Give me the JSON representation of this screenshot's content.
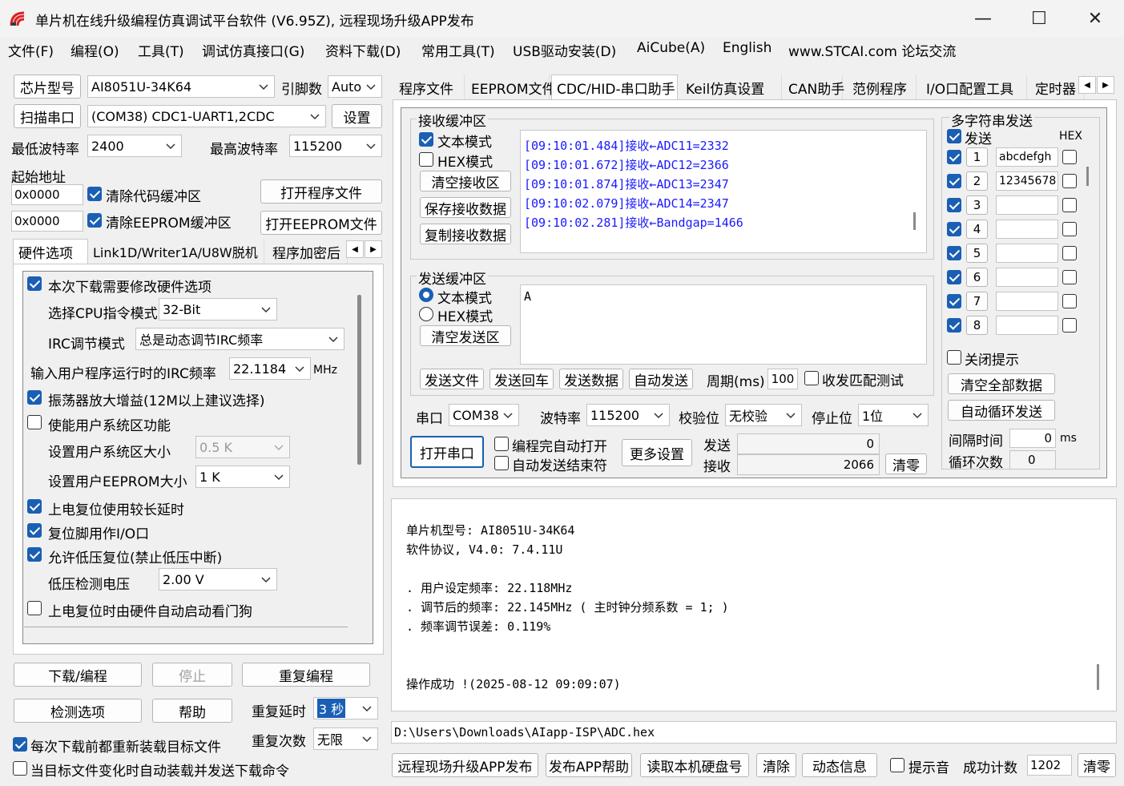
{
  "window": {
    "title": "单片机在线升级编程仿真调试平台软件 (V6.95Z), 远程现场升级APP发布"
  },
  "menu": [
    "文件(F)",
    "编程(O)",
    "工具(T)",
    "调试仿真接口(G)",
    "资料下载(D)",
    "常用工具(T)",
    "USB驱动安装(D)",
    "AiCube(A)",
    "English",
    "www.STCAI.com 论坛交流"
  ],
  "left": {
    "chip_btn": "芯片型号",
    "chip_value": "AI8051U-34K64",
    "pin_label": "引脚数",
    "pin_value": "Auto",
    "scan_btn": "扫描串口",
    "port_value": "(COM38) CDC1-UART1,2CDC",
    "settings_btn": "设置",
    "min_baud_label": "最低波特率",
    "min_baud": "2400",
    "max_baud_label": "最高波特率",
    "max_baud": "115200",
    "start_addr_label": "起始地址",
    "addr1": "0x0000",
    "clear_code": "清除代码缓冲区",
    "open_prog": "打开程序文件",
    "addr2": "0x0000",
    "clear_eeprom": "清除EEPROM缓冲区",
    "open_eeprom": "打开EEPROM文件",
    "tabs": [
      "硬件选项",
      "Link1D/Writer1A/U8W脱机",
      "程序加密后"
    ],
    "hw": {
      "modify_hw": "本次下载需要修改硬件选项",
      "cpu_mode_label": "选择CPU指令模式",
      "cpu_mode": "32-Bit",
      "irc_mode_label": "IRC调节模式",
      "irc_mode": "总是动态调节IRC频率",
      "irc_freq_label": "输入用户程序运行时的IRC频率",
      "irc_freq": "22.1184",
      "mhz": "MHz",
      "osc_gain": "振荡器放大增益(12M以上建议选择)",
      "user_sys": "使能用户系统区功能",
      "sys_size_label": "设置用户系统区大小",
      "sys_size": "0.5 K",
      "eeprom_size_label": "设置用户EEPROM大小",
      "eeprom_size": "1    K",
      "long_delay": "上电复位使用较长延时",
      "reset_io": "复位脚用作I/O口",
      "lvr": "允许低压复位(禁止低压中断)",
      "lvd_label": "低压检测电压",
      "lvd": "2.00 V",
      "wdt": "上电复位时由硬件自动启动看门狗"
    },
    "download_btn": "下载/编程",
    "stop_btn": "停止",
    "reprog_btn": "重复编程",
    "detect_btn": "检测选项",
    "help_btn": "帮助",
    "repeat_delay_label": "重复延时",
    "repeat_delay": "3 秒",
    "repeat_count_label": "重复次数",
    "repeat_count": "无限",
    "reload_cb": "每次下载前都重新装载目标文件",
    "auto_send_cb": "当目标文件变化时自动装载并发送下载命令"
  },
  "right_tabs": [
    "程序文件",
    "EEPROM文件",
    "CDC/HID-串口助手",
    "Keil仿真设置",
    "CAN助手",
    "范例程序",
    "I/O口配置工具",
    "定时器"
  ],
  "serial": {
    "rx_group": "接收缓冲区",
    "text_mode": "文本模式",
    "hex_mode": "HEX模式",
    "clear_rx": "清空接收区",
    "save_rx": "保存接收数据",
    "copy_rx": "复制接收数据",
    "rx_lines": [
      "[09:10:01.484]接收←ADC11=2332",
      "[09:10:01.672]接收←ADC12=2366",
      "[09:10:01.874]接收←ADC13=2347",
      "[09:10:02.079]接收←ADC14=2347",
      "[09:10:02.281]接收←Bandgap=1466"
    ],
    "tx_group": "发送缓冲区",
    "tx_text": "A",
    "clear_tx": "清空发送区",
    "send_file": "发送文件",
    "send_cr": "发送回车",
    "send_data": "发送数据",
    "auto_send": "自动发送",
    "period_label": "周期(ms)",
    "period": "100",
    "match_test": "收发匹配测试",
    "port_label": "串口",
    "port": "COM38",
    "baud_label": "波特率",
    "baud": "115200",
    "parity_label": "校验位",
    "parity": "无校验",
    "stop_label": "停止位",
    "stop": "1位",
    "open_port": "打开串口",
    "auto_open": "编程完自动打开",
    "auto_end": "自动发送结束符",
    "more_settings": "更多设置",
    "tx_count_label": "发送",
    "tx_count": "0",
    "rx_count_label": "接收",
    "rx_count": "2066",
    "clear_count": "清零"
  },
  "multi": {
    "title": "多字符串发送",
    "send_label": "发送",
    "hex_label": "HEX",
    "rows": [
      {
        "n": "1",
        "v": "abcdefgh"
      },
      {
        "n": "2",
        "v": "12345678"
      },
      {
        "n": "3",
        "v": ""
      },
      {
        "n": "4",
        "v": ""
      },
      {
        "n": "5",
        "v": ""
      },
      {
        "n": "6",
        "v": ""
      },
      {
        "n": "7",
        "v": ""
      },
      {
        "n": "8",
        "v": ""
      }
    ],
    "close_tip": "关闭提示",
    "clear_all": "清空全部数据",
    "auto_loop": "自动循环发送",
    "interval_label": "间隔时间",
    "interval": "0",
    "ms": "ms",
    "loop_count_label": "循环次数",
    "loop_count": "0"
  },
  "log": {
    "lines": [
      "单片机型号: AI8051U-34K64",
      "软件协议, V4.0: 7.4.11U",
      "",
      ". 用户设定频率: 22.118MHz",
      ". 调节后的频率: 22.145MHz ( 主时钟分频系数 = 1; )",
      ". 频率调节误差: 0.119%",
      "",
      "",
      "操作成功 !(2025-08-12 09:09:07)"
    ]
  },
  "path": "D:\\Users\\Downloads\\AIapp-ISP\\ADC.hex",
  "bottom": {
    "remote_btn": "远程现场升级APP发布",
    "app_help": "发布APP帮助",
    "read_disk": "读取本机硬盘号",
    "clear": "清除",
    "dyn_info": "动态信息",
    "beep": "提示音",
    "success_label": "成功计数",
    "success_count": "1202",
    "reset": "清零"
  }
}
